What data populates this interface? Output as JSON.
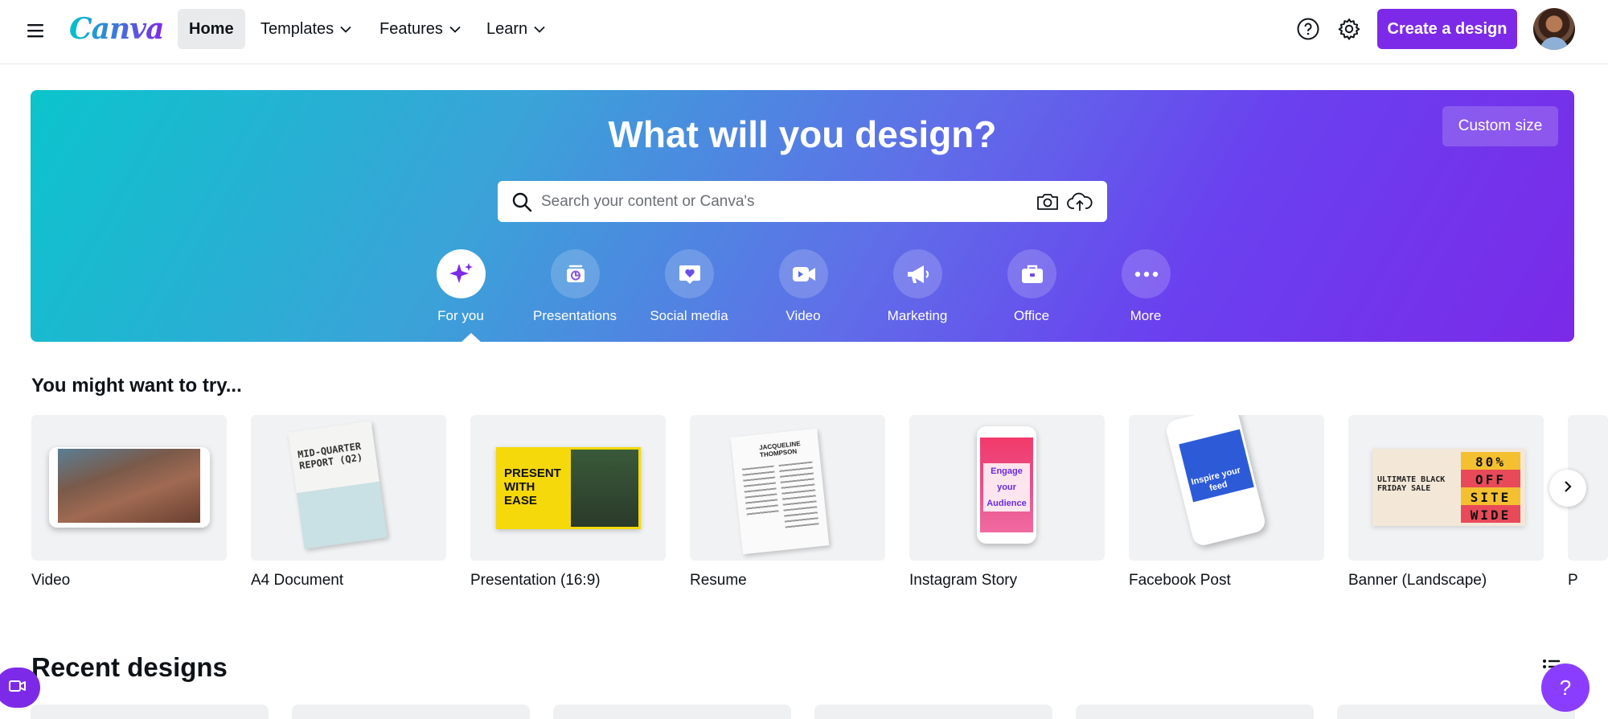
{
  "app": {
    "logo_text": "Canva",
    "brand_color": "#7d2ae8"
  },
  "nav": {
    "items": [
      {
        "label": "Home",
        "active": true
      },
      {
        "label": "Templates",
        "has_dropdown": true
      },
      {
        "label": "Features",
        "has_dropdown": true
      },
      {
        "label": "Learn",
        "has_dropdown": true
      }
    ],
    "create_label": "Create a design"
  },
  "hero": {
    "title": "What will you design?",
    "custom_size_label": "Custom size",
    "search_placeholder": "Search your content or Canva's",
    "categories": [
      {
        "label": "For you",
        "icon": "sparkle-icon",
        "selected": true
      },
      {
        "label": "Presentations",
        "icon": "presentation-icon"
      },
      {
        "label": "Social media",
        "icon": "heart-chat-icon"
      },
      {
        "label": "Video",
        "icon": "video-camera-icon"
      },
      {
        "label": "Marketing",
        "icon": "megaphone-icon"
      },
      {
        "label": "Office",
        "icon": "briefcase-icon"
      },
      {
        "label": "More",
        "icon": "more-dots-icon"
      }
    ]
  },
  "suggestions": {
    "title": "You might want to try...",
    "items": [
      {
        "label": "Video"
      },
      {
        "label": "A4 Document",
        "thumb_text": "MID-QUARTER REPORT (Q2)"
      },
      {
        "label": "Presentation (16:9)",
        "thumb_text": "PRESENT WITH EASE"
      },
      {
        "label": "Resume",
        "thumb_text": "JACQUELINE THOMPSON"
      },
      {
        "label": "Instagram Story",
        "thumb_text": "Engage your Audience"
      },
      {
        "label": "Facebook Post",
        "thumb_text": "Inspire your feed"
      },
      {
        "label": "Banner (Landscape)",
        "thumb_text": "ULTIMATE BLACK FRIDAY SALE",
        "thumb_text_2": "80% OFF SITE WIDE"
      },
      {
        "label": "P"
      }
    ]
  },
  "recent": {
    "title": "Recent designs"
  },
  "help_label": "?"
}
